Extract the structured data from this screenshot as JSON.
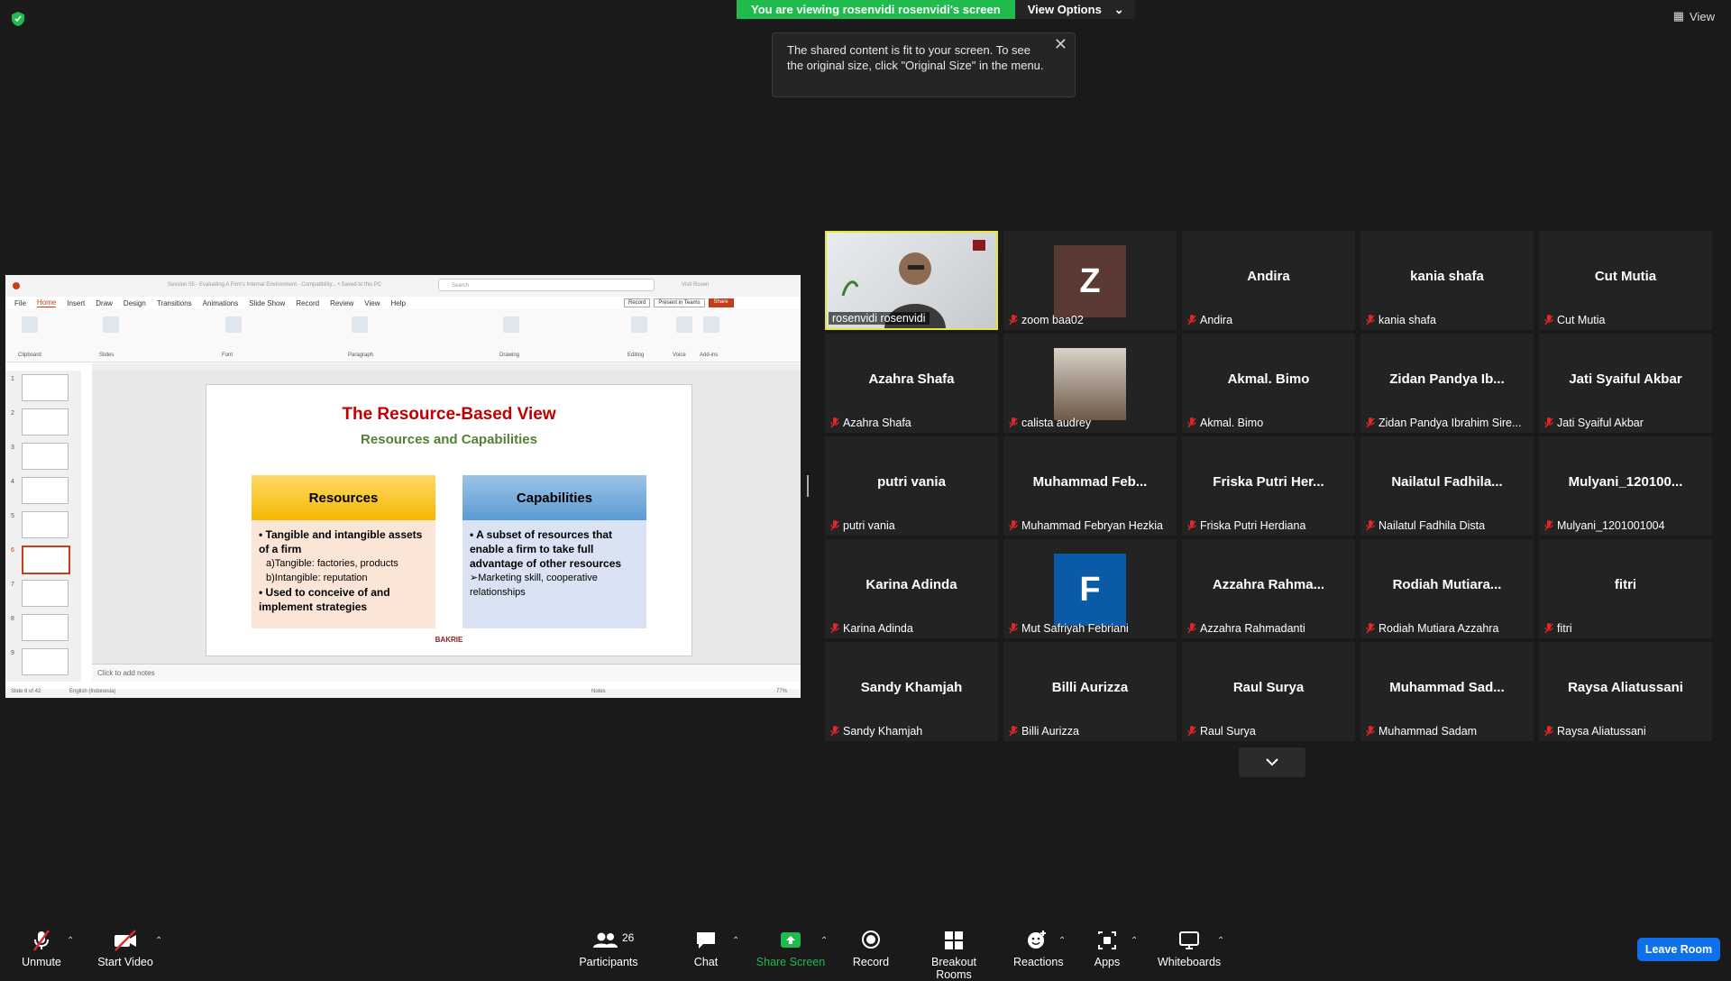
{
  "banner": {
    "viewing_text": "You are viewing rosenvidi rosenvidi's screen",
    "view_options": "View Options",
    "view_label": "View"
  },
  "tooltip": {
    "text": "The shared content is fit to your screen. To see the original size, click \"Original Size\" in the menu."
  },
  "ppt": {
    "window_title": "Session 05 - Evaluating A Firm's Internal Environment - Compatibility... • Saved to this PC",
    "search_placeholder": "Search",
    "user": "Visit Rosen",
    "menu": [
      "File",
      "Home",
      "Insert",
      "Draw",
      "Design",
      "Transitions",
      "Animations",
      "Slide Show",
      "Record",
      "Review",
      "View",
      "Help"
    ],
    "buttons": {
      "record": "Record",
      "present": "Present in Teams",
      "share": "Share"
    },
    "ribbon_groups": [
      "Clipboard",
      "Slides",
      "Font",
      "Paragraph",
      "Drawing",
      "Editing",
      "Voice",
      "Add-ins"
    ],
    "thumb_numbers": [
      "1",
      "2",
      "3",
      "4",
      "5",
      "6",
      "7",
      "8",
      "9"
    ],
    "notes_placeholder": "Click to add notes",
    "status_left": "Slide 6 of 42",
    "status_lang": "English (Indonesia)",
    "status_notes": "Notes",
    "zoom": "77%",
    "slide": {
      "title": "The Resource-Based View",
      "subtitle": "Resources and Capabilities",
      "resources_head": "Resources",
      "resources_b1": "• Tangible and intangible assets of a firm",
      "resources_a": "a)Tangible: factories, products",
      "resources_b": "b)Intangible: reputation",
      "resources_b2": "• Used to conceive of and implement strategies",
      "capabilities_head": "Capabilities",
      "capabilities_b1": "• A subset of resources that enable a firm to take full advantage of other resources",
      "capabilities_b2": "➢Marketing skill, cooperative relationships",
      "logo": "BAKRIE"
    }
  },
  "participants": [
    {
      "name": "",
      "label": "rosenvidi rosenvidi",
      "video": true
    },
    {
      "name": "",
      "label": "zoom baa02",
      "avatar": "Z",
      "avatar_color": "#5b3a33"
    },
    {
      "name": "Andira",
      "label": "Andira"
    },
    {
      "name": "kania shafa",
      "label": "kania shafa"
    },
    {
      "name": "Cut Mutia",
      "label": "Cut Mutia"
    },
    {
      "name": "Azahra Shafa",
      "label": "Azahra Shafa"
    },
    {
      "name": "",
      "label": "calista audrey",
      "photo": true
    },
    {
      "name": "Akmal. Bimo",
      "label": "Akmal. Bimo"
    },
    {
      "name": "Zidan Pandya Ib...",
      "label": "Zidan Pandya Ibrahim Sire..."
    },
    {
      "name": "Jati Syaiful Akbar",
      "label": "Jati Syaiful Akbar"
    },
    {
      "name": "putri vania",
      "label": "putri vania"
    },
    {
      "name": "Muhammad Feb...",
      "label": "Muhammad Febryan Hezkia"
    },
    {
      "name": "Friska Putri Her...",
      "label": "Friska Putri Herdiana"
    },
    {
      "name": "Nailatul Fadhila...",
      "label": "Nailatul Fadhila Dista"
    },
    {
      "name": "Mulyani_120100...",
      "label": "Mulyani_1201001004"
    },
    {
      "name": "Karina Adinda",
      "label": "Karina Adinda"
    },
    {
      "name": "",
      "label": "Mut Safriyah Febriani",
      "avatar": "F",
      "avatar_color": "#0b5aa8"
    },
    {
      "name": "Azzahra Rahma...",
      "label": "Azzahra Rahmadanti"
    },
    {
      "name": "Rodiah Mutiara...",
      "label": "Rodiah Mutiara Azzahra"
    },
    {
      "name": "fitri",
      "label": "fitri"
    },
    {
      "name": "Sandy Khamjah",
      "label": "Sandy Khamjah"
    },
    {
      "name": "Billi Aurizza",
      "label": "Billi Aurizza"
    },
    {
      "name": "Raul Surya",
      "label": "Raul Surya"
    },
    {
      "name": "Muhammad Sad...",
      "label": "Muhammad Sadam"
    },
    {
      "name": "Raysa Aliatussani",
      "label": "Raysa Aliatussani"
    }
  ],
  "toolbar": {
    "unmute": "Unmute",
    "start_video": "Start Video",
    "participants": "Participants",
    "participants_count": "26",
    "chat": "Chat",
    "share_screen": "Share Screen",
    "record": "Record",
    "breakout": "Breakout Rooms",
    "reactions": "Reactions",
    "apps": "Apps",
    "whiteboards": "Whiteboards",
    "leave": "Leave Room"
  },
  "colors": {
    "share_green": "#1fbb4c",
    "leave_blue": "#0e71eb",
    "active_speaker": "#e6e63a",
    "mic_muted": "#e02828"
  }
}
